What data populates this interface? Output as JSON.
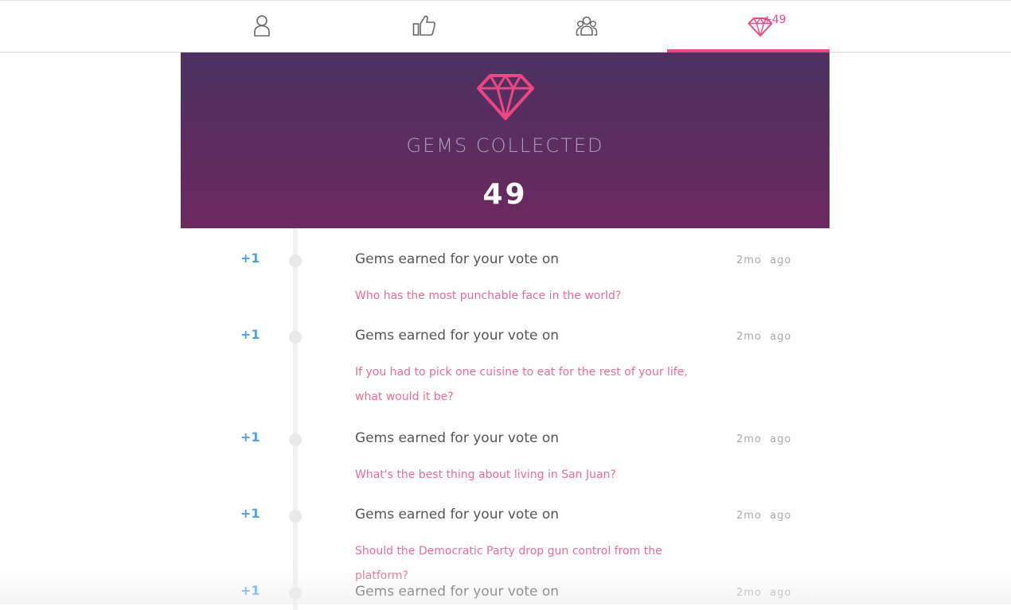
{
  "tabs": [
    {
      "icon": "user-icon"
    },
    {
      "icon": "thumbs-up-icon"
    },
    {
      "icon": "group-icon"
    },
    {
      "icon": "gem-icon",
      "badge": "+49",
      "active": true
    }
  ],
  "hero": {
    "title": "GEMS COLLECTED",
    "count": "49"
  },
  "entries": [
    {
      "points": "+1",
      "heading": "Gems earned for your vote on",
      "time": "2mo  ago",
      "question": "Who has the most punchable face in the world?"
    },
    {
      "points": "+1",
      "heading": "Gems earned for your vote on",
      "time": "2mo  ago",
      "question": "If you had to pick one cuisine to eat for the rest of your life, what would it be?"
    },
    {
      "points": "+1",
      "heading": "Gems earned for your vote on",
      "time": "2mo  ago",
      "question": "What's the best thing about living in San Juan?"
    },
    {
      "points": "+1",
      "heading": "Gems earned for your vote on",
      "time": "2mo  ago",
      "question": "Should the Democratic Party drop gun control from the platform?"
    },
    {
      "points": "+1",
      "heading": "Gems earned for your vote on",
      "time": "2mo  ago"
    }
  ],
  "colors": {
    "accent": "#f0457f",
    "points": "#4aa3e8",
    "hero_top": "#4b3260",
    "hero_bottom": "#6c2860"
  }
}
